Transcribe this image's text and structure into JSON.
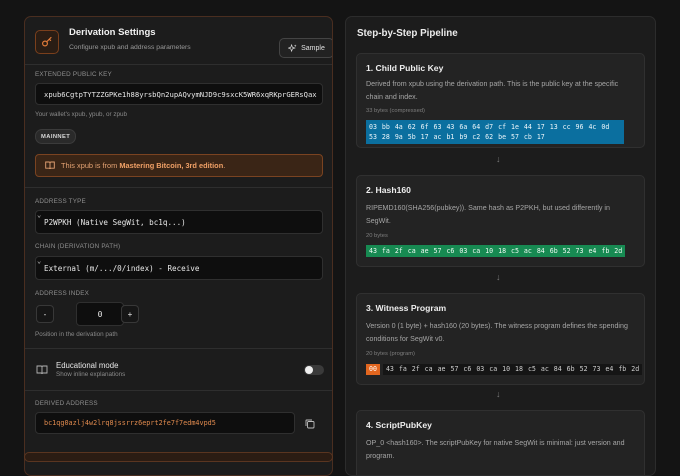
{
  "left": {
    "title": "Derivation Settings",
    "subtitle": "Configure xpub and address parameters",
    "sample_label": "Sample",
    "xpub_label": "EXTENDED PUBLIC KEY",
    "xpub_value": "xpub6CgtpTYTZZGPKe1h88yrsbQn2upAQvymNJD9c9sxcK5WR6xqRKprGERsQax",
    "xpub_hint": "Your wallet's xpub, ypub, or zpub",
    "network_badge": "MAINNET",
    "note_prefix": "This xpub is from ",
    "note_source": "Mastering Bitcoin, 3rd edition",
    "note_suffix": ".",
    "address_type_label": "ADDRESS TYPE",
    "address_type_value": "P2WPKH (Native SegWit, bc1q...)",
    "chain_label": "CHAIN (DERIVATION PATH)",
    "chain_value": "External (m/.../0/index) - Receive",
    "index_label": "ADDRESS INDEX",
    "index_minus": "-",
    "index_value": "0",
    "index_plus": "+",
    "index_hint": "Position in the derivation path",
    "edu_title": "Educational mode",
    "edu_sub": "Show inline explanations",
    "edu_enabled": false,
    "derived_label": "DERIVED ADDRESS",
    "derived_value": "bc1qg0azlj4w2lrq8jssrrz6eprt2fe7f7edm4vpd5"
  },
  "right": {
    "title": "Step-by-Step Pipeline",
    "steps": [
      {
        "title": "1. Child Public Key",
        "desc": "Derived from xpub using the derivation path. This is the public key at the specific chain and index.",
        "meta": "33 bytes (compressed)",
        "hex": "03 bb 4a 62 6f 63 43 6a 64 d7 cf 1e 44 17 13 cc 96 4c 0d 53 28 9a 5b 17 ac b1 b9 c2 62 be 57 cb 17"
      },
      {
        "title": "2. Hash160",
        "desc": "RIPEMD160(SHA256(pubkey)). Same hash as P2PKH, but used differently in SegWit.",
        "meta": "20 bytes",
        "hex": "43 fa 2f ca ae 57 c6 03 ca 10 18 c5 ac 84 6b 52 73 e4 fb 2d"
      },
      {
        "title": "3. Witness Program",
        "desc": "Version 0 (1 byte) + hash160 (20 bytes). The witness program defines the spending conditions for SegWit v0.",
        "meta": "20 bytes (program)",
        "version": "00",
        "hex": "43 fa 2f ca ae 57 c6 03 ca 10 18 c5 ac 84 6b 52 73 e4 fb 2d"
      },
      {
        "title": "4. ScriptPubKey",
        "desc": "OP_0 <hash160>. The scriptPubKey for native SegWit is minimal: just version and program."
      }
    ],
    "arrow": "↓"
  },
  "colors": {
    "accent_orange": "#e2661f",
    "hex_blue": "#0b6f9f",
    "hex_green": "#178a52",
    "address_orange": "#e08a4e"
  }
}
